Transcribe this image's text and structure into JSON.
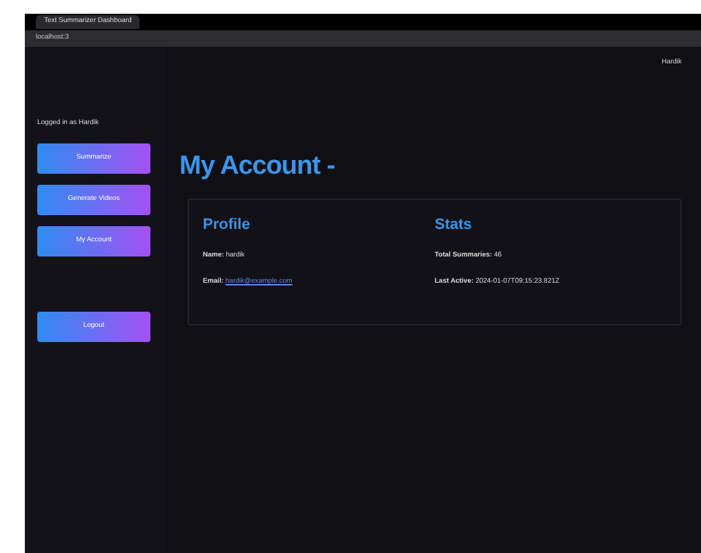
{
  "browser": {
    "tab_title": "Text Summarizer Dashboard",
    "address": "localhost:3"
  },
  "header": {
    "user": "Hardik"
  },
  "sidebar": {
    "greeting": "Logged in as Hardik",
    "items": [
      {
        "label": "Summarize"
      },
      {
        "label": "Generate Videos"
      },
      {
        "label": "My Account"
      }
    ],
    "logout": "Logout"
  },
  "main": {
    "title": "My Account -",
    "profile": {
      "heading": "Profile",
      "fields": [
        {
          "label": "Name:",
          "value": "hardik",
          "kind": "text"
        },
        {
          "label": "Email:",
          "value": "hardik@example.com",
          "kind": "link"
        }
      ]
    },
    "stats": {
      "heading": "Stats",
      "fields": [
        {
          "label": "Total Summaries:",
          "value": "46",
          "kind": "text"
        },
        {
          "label": "Last Active:",
          "value": "2024-01-07T09:15:23.821Z",
          "kind": "text"
        }
      ]
    }
  }
}
